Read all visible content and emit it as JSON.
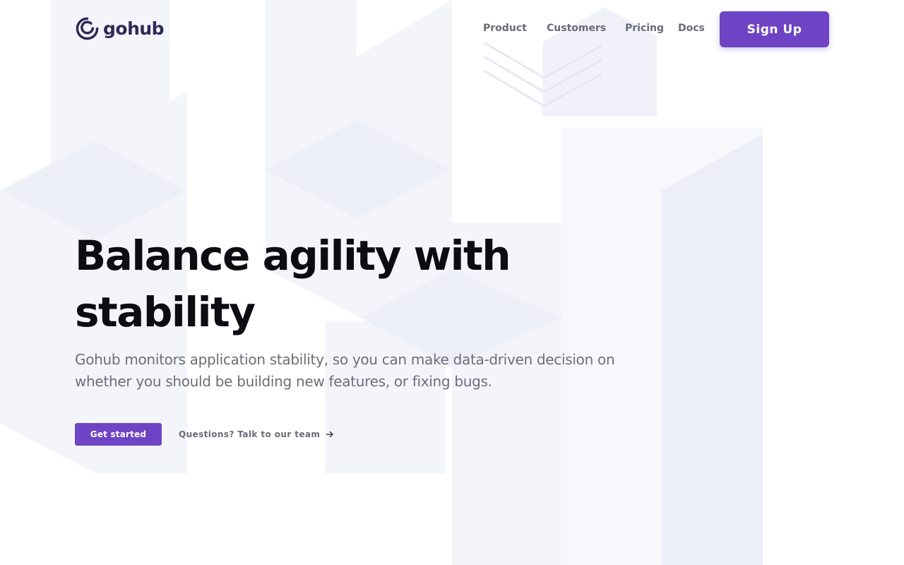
{
  "brand": {
    "name": "gohub",
    "accent": "#6e44c4",
    "logo_color": "#2e2a57"
  },
  "nav": {
    "items": [
      {
        "label": "Product"
      },
      {
        "label": "Customers"
      },
      {
        "label": "Pricing"
      },
      {
        "label": "Docs"
      }
    ],
    "signup_label": "Sign Up"
  },
  "hero": {
    "title": "Balance agility with stability",
    "subtitle": "Gohub monitors application stability, so you can make data-driven decision on whether you should be building new features, or fixing bugs.",
    "primary_cta": "Get started",
    "secondary_cta": "Questions? Talk to our team",
    "secondary_icon": "arrow-right-icon"
  }
}
